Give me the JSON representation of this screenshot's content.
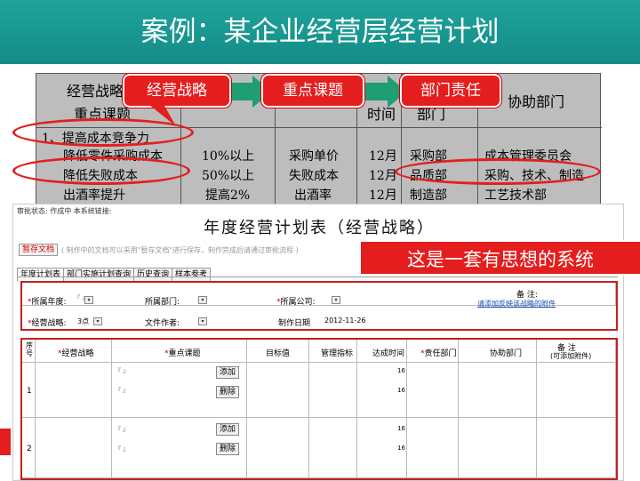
{
  "slide_title": "案例：某企业经营层经营计划",
  "bg_table": {
    "header_left_1": "经营战略",
    "header_left_2": "重点课题",
    "header_time": "时间",
    "header_dept": "部门",
    "header_assist": "协助部门",
    "section_1": "1、提高成本竞争力",
    "rows": [
      {
        "topic": "降低零件采购成本",
        "target": "10%以上",
        "metric": "采购单价",
        "time": "12月",
        "dept": "采购部",
        "assist": "成本管理委员会"
      },
      {
        "topic": "降低失败成本",
        "target": "50%以上",
        "metric": "失败成本",
        "time": "12月",
        "dept": "品质部",
        "assist": "采购、技术、制造"
      },
      {
        "topic": "出酒率提升",
        "target": "提高2%",
        "metric": "出酒率",
        "time": "12月",
        "dept": "制造部",
        "assist": "工艺技术部"
      }
    ]
  },
  "callouts": {
    "strategy": "经营战略",
    "key_topics": "重点课题",
    "dept_responsibility": "部门责任"
  },
  "form": {
    "status_line": "审批状态: 作成中    本系统链接:",
    "title": "年度经营计划表（经营战略）",
    "temp_save": "暂存文档",
    "hint": "( 制作中的文档可以采用\"暂存文档\"进行保存，制作完成后请通过审批流程 )",
    "tabs": [
      "年度计划表",
      "部门实施计划查询",
      "历史查询",
      "样本参考"
    ],
    "fields": {
      "year_label": "所属年度:",
      "dept_label": "所属部门:",
      "company_label": "所属公司:",
      "remarks_label": "备  注:",
      "remarks_link": "请添加反映该战略的附件",
      "strategy_label": "经营战略:",
      "strategy_value": "3点",
      "author_label": "文件作者:",
      "date_label": "制作日期",
      "date_value": "2012-11-26"
    },
    "grid_headers": {
      "seq": "序号",
      "strategy": "经营战略",
      "topics": "重点课题",
      "target": "目标值",
      "metric": "管理指标",
      "time": "达成时间",
      "dept": "责任部门",
      "assist": "协助部门",
      "remarks_1": "备  注",
      "remarks_2": "(可添加附件)"
    },
    "rows": [
      {
        "seq": "1",
        "time_1": "16",
        "time_2": "16"
      },
      {
        "seq": "2",
        "time_1": "16",
        "time_2": "16"
      }
    ],
    "add_label": "添加",
    "delete_label": "删除"
  },
  "system_banner": "这是一套有思想的系统",
  "colors": {
    "banner": "#1fa39c",
    "callout": "#e41e1e",
    "arrow": "#1f9e74"
  }
}
